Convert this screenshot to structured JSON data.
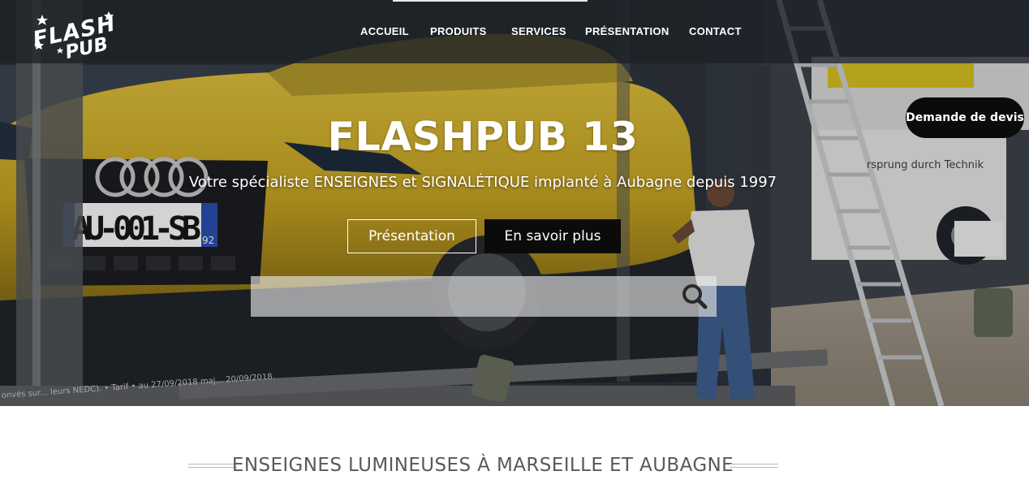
{
  "brand": {
    "logo_line1": "FLASH",
    "logo_line2": "PUB"
  },
  "nav": {
    "items": [
      {
        "label": "ACCUEIL"
      },
      {
        "label": "PRODUITS"
      },
      {
        "label": "SERVICES"
      },
      {
        "label": "PRÉSENTATION"
      },
      {
        "label": "CONTACT"
      }
    ]
  },
  "hero": {
    "title": "FLASHPUB 13",
    "subtitle": "Votre spécialiste ENSEIGNES et SIGNALÉTIQUE implanté à Aubagne depuis 1997",
    "primary_button": "Présentation",
    "secondary_button": "En savoir plus",
    "scene_texts": {
      "plate": "AU-001-SB",
      "plate_dept": "92",
      "truck_slogan": "rsprung durch Technik",
      "window_fineprint": "onvés sur... leurs NEDC). • Tarif • au 27/09/2018 maj... 20/09/2018."
    }
  },
  "search": {
    "placeholder": "",
    "icon": "search-icon"
  },
  "quote_button": {
    "label": "Demande de devis"
  },
  "section": {
    "heading": "ENSEIGNES LUMINEUSES À MARSEILLE ET AUBAGNE"
  },
  "colors": {
    "header_bg": "#1c2126",
    "button_dark": "#0b0b0b",
    "car_yellow": "#d9b52a",
    "heading_text": "#555a60"
  }
}
